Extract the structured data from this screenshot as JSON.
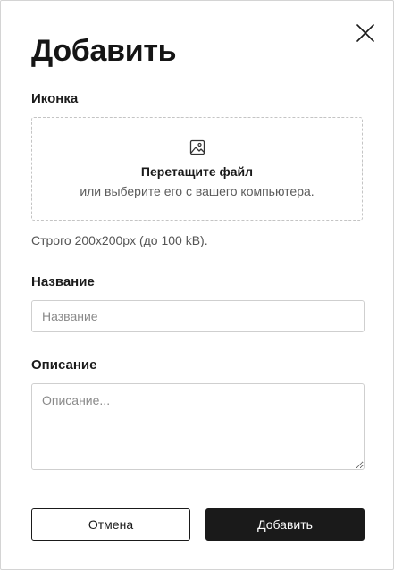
{
  "dialog": {
    "title": "Добавить"
  },
  "icon_field": {
    "label": "Иконка",
    "dropzone_title": "Перетащите файл",
    "dropzone_subtitle": "или выберите его с вашего компьютера.",
    "hint": "Строго 200x200px (до 100 kB)."
  },
  "name_field": {
    "label": "Название",
    "placeholder": "Название",
    "value": ""
  },
  "description_field": {
    "label": "Описание",
    "placeholder": "Описание...",
    "value": ""
  },
  "buttons": {
    "cancel": "Отмена",
    "submit": "Добавить"
  },
  "icons": {
    "close": "close-icon",
    "image": "image-icon"
  },
  "colors": {
    "primary": "#1a1a1a",
    "border": "#cfcfcf",
    "dashed_border": "#c4c4c4",
    "muted_text": "#555555"
  }
}
